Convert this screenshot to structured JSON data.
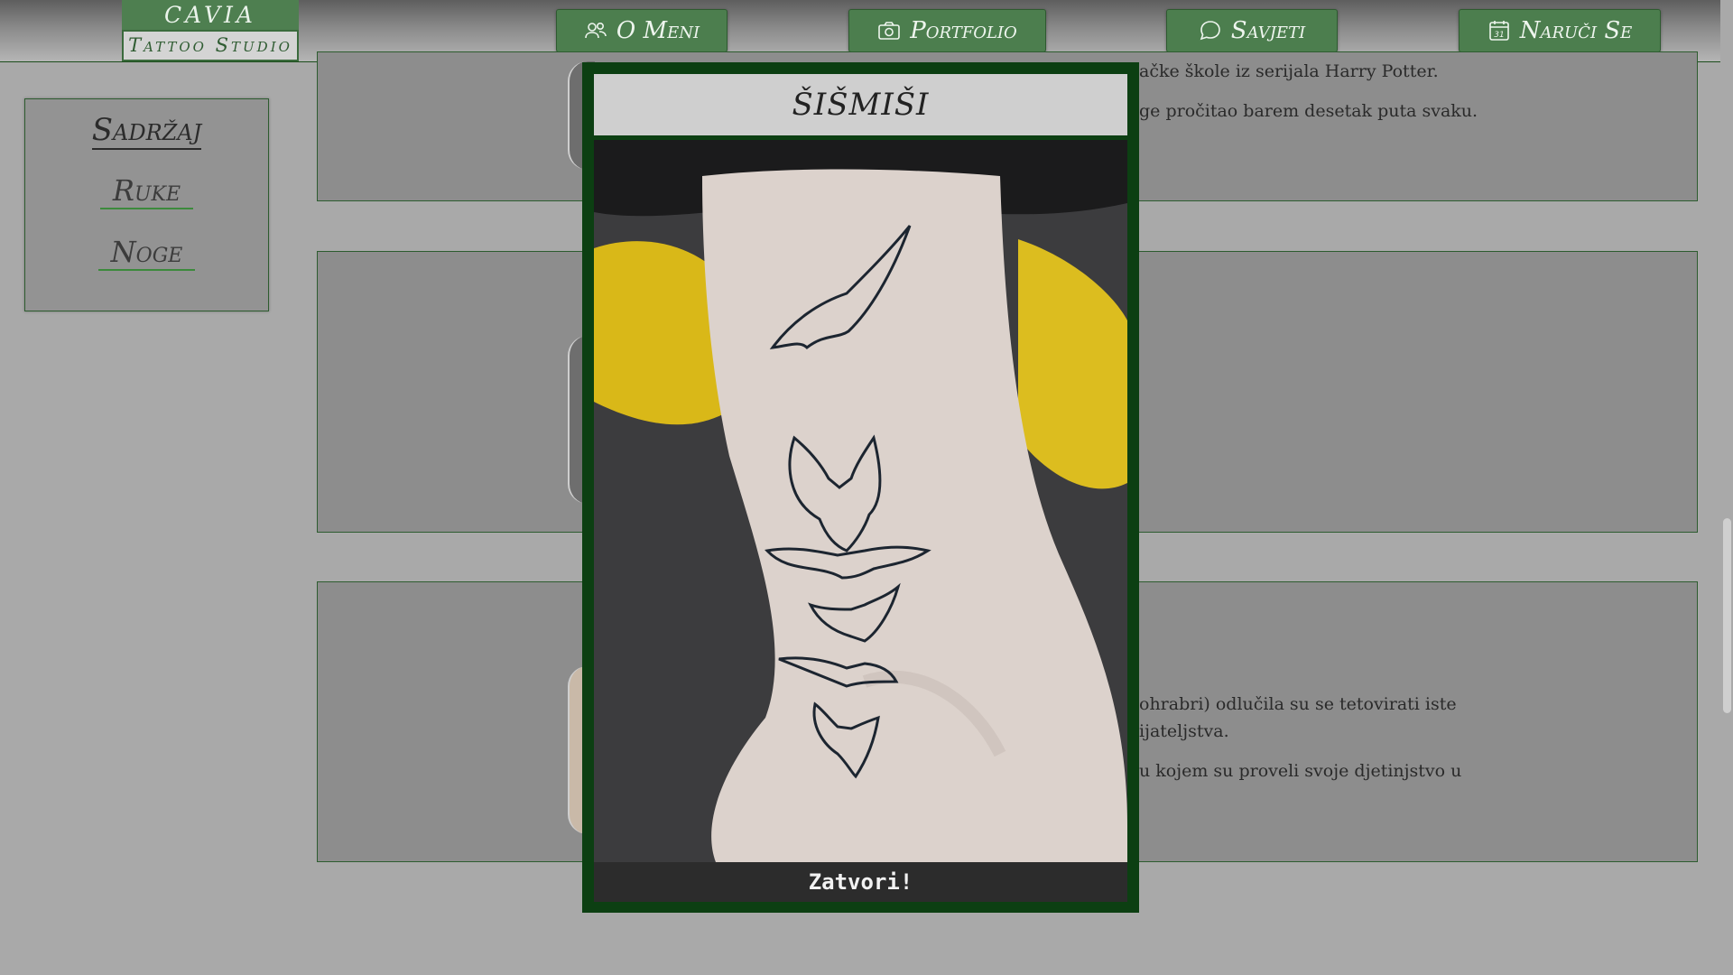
{
  "logo": {
    "line1": "CAVIA",
    "line2": "Tattoo Studio"
  },
  "nav": [
    {
      "label": "O Meni",
      "icon": "people-icon"
    },
    {
      "label": "Portfolio",
      "icon": "camera-icon"
    },
    {
      "label": "Savjeti",
      "icon": "chat-bubble-icon"
    },
    {
      "label": "Naruči Se",
      "icon": "calendar-icon",
      "calendar_day": "31"
    }
  ],
  "sidebar": {
    "title": "Sadržaj",
    "links": [
      "Ruke",
      "Noge"
    ]
  },
  "cards": [
    {
      "lines": [
        "ačke škole iz serijala Harry Potter.",
        "ge pročitao barem desetak puta svaku."
      ]
    },
    {
      "lines": []
    },
    {
      "lines": [
        "ohrabri) odlučila su se tetovirati iste",
        "ijateljstva.",
        "u kojem su proveli svoje djetinjstvo u"
      ]
    }
  ],
  "modal": {
    "title": "ŠIŠMIŠI",
    "close_label": "Zatvori!"
  },
  "colors": {
    "accent_green": "#4c7e4e",
    "modal_border": "#0c3f12",
    "page_bg": "#a9a9a9"
  }
}
